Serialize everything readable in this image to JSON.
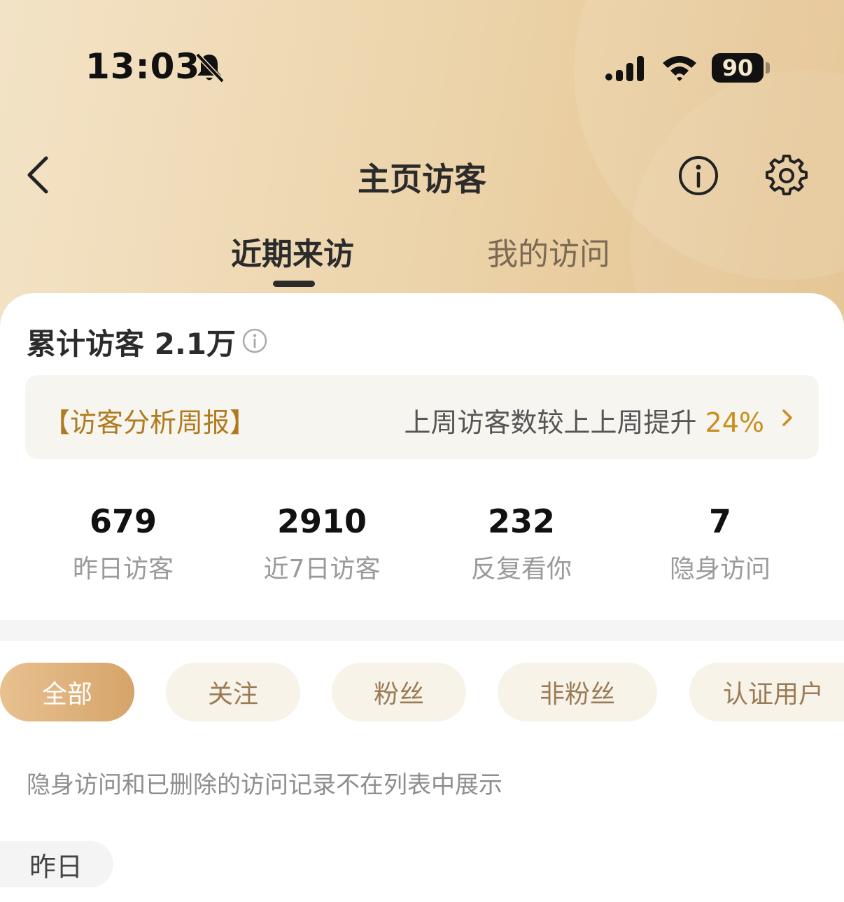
{
  "status_bar": {
    "time": "13:03",
    "battery": "90"
  },
  "nav": {
    "title": "主页访客"
  },
  "tabs": [
    {
      "label": "近期来访",
      "active": true
    },
    {
      "label": "我的访问",
      "active": false
    }
  ],
  "summary": {
    "total_label": "累计访客 2.1万"
  },
  "weekly_report": {
    "title": "【访客分析周报】",
    "desc": "上周访客数较上上周提升 ",
    "percent": "24%"
  },
  "stats": [
    {
      "value": "679",
      "label": "昨日访客"
    },
    {
      "value": "2910",
      "label": "近7日访客"
    },
    {
      "value": "232",
      "label": "反复看你"
    },
    {
      "value": "7",
      "label": "隐身访问"
    }
  ],
  "filters": [
    {
      "label": "全部",
      "active": true
    },
    {
      "label": "关注",
      "active": false
    },
    {
      "label": "粉丝",
      "active": false
    },
    {
      "label": "非粉丝",
      "active": false
    },
    {
      "label": "认证用户",
      "active": false
    }
  ],
  "note": "隐身访问和已删除的访问记录不在列表中展示",
  "section": {
    "day_label": "昨日"
  },
  "colors": {
    "header_start": "#f3e3c6",
    "header_end": "#e4c28e",
    "accent_gold": "#c98f1e",
    "chip_active_start": "#e8c190",
    "chip_active_end": "#d6a46a"
  }
}
